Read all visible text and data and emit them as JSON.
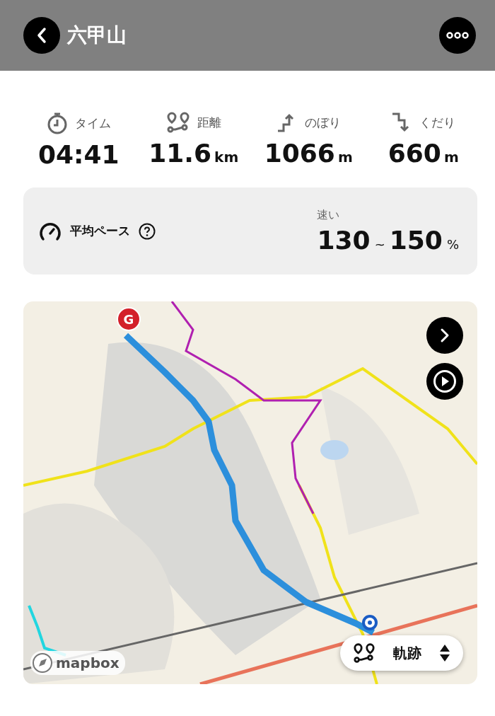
{
  "header": {
    "title": "六甲山"
  },
  "stats": [
    {
      "kind": "time",
      "label": "タイム",
      "value": "04:41"
    },
    {
      "kind": "distance",
      "label": "距離",
      "value": "11.6",
      "unit": "km"
    },
    {
      "kind": "ascent",
      "label": "のぼり",
      "value": "1066",
      "unit": "m"
    },
    {
      "kind": "descent",
      "label": "くだり",
      "value": "660",
      "unit": "m"
    }
  ],
  "pace": {
    "label": "平均ペース",
    "category": "速い",
    "low": "130",
    "separator": "~",
    "high": "150",
    "unit": "%"
  },
  "map": {
    "kind": "picture",
    "goal_marker": "G",
    "attribution": "mapbox",
    "track_selector": {
      "label": "軌跡"
    }
  }
}
